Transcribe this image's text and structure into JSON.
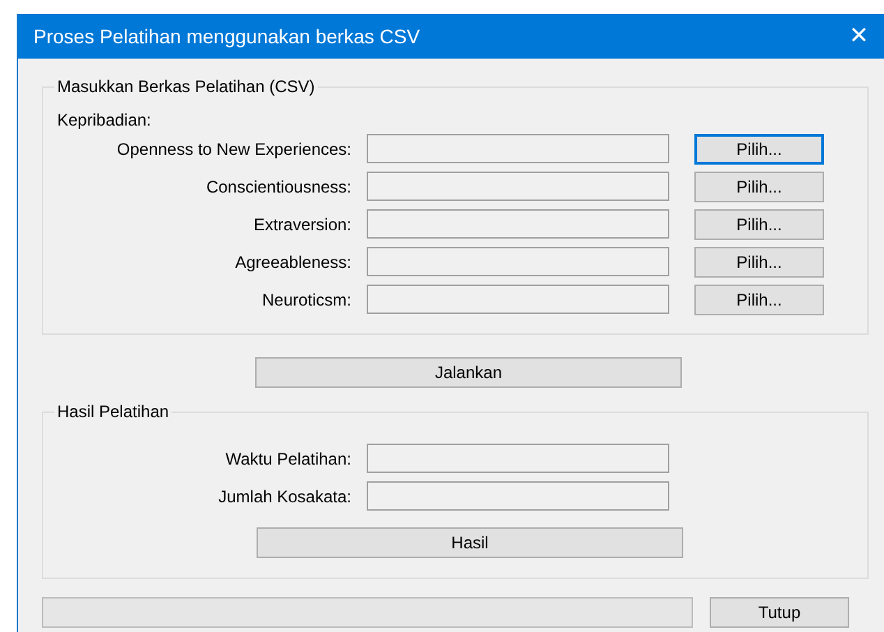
{
  "window": {
    "title": "Proses Pelatihan menggunakan berkas CSV",
    "close": "✕"
  },
  "input_group": {
    "title": "Masukkan Berkas Pelatihan (CSV)",
    "subtitle": "Kepribadian:",
    "rows": [
      {
        "label": "Openness to New Experiences:",
        "button": "Pilih...",
        "focused": true
      },
      {
        "label": "Conscientiousness:",
        "button": "Pilih...",
        "focused": false
      },
      {
        "label": "Extraversion:",
        "button": "Pilih...",
        "focused": false
      },
      {
        "label": "Agreeableness:",
        "button": "Pilih...",
        "focused": false
      },
      {
        "label": "Neuroticsm:",
        "button": "Pilih...",
        "focused": false
      }
    ]
  },
  "run_button": "Jalankan",
  "result_group": {
    "title": "Hasil Pelatihan",
    "rows": [
      {
        "label": "Waktu Pelatihan:"
      },
      {
        "label": "Jumlah Kosakata:"
      }
    ],
    "button": "Hasil"
  },
  "progress": {
    "level": 0
  },
  "close_button": "Tutup"
}
